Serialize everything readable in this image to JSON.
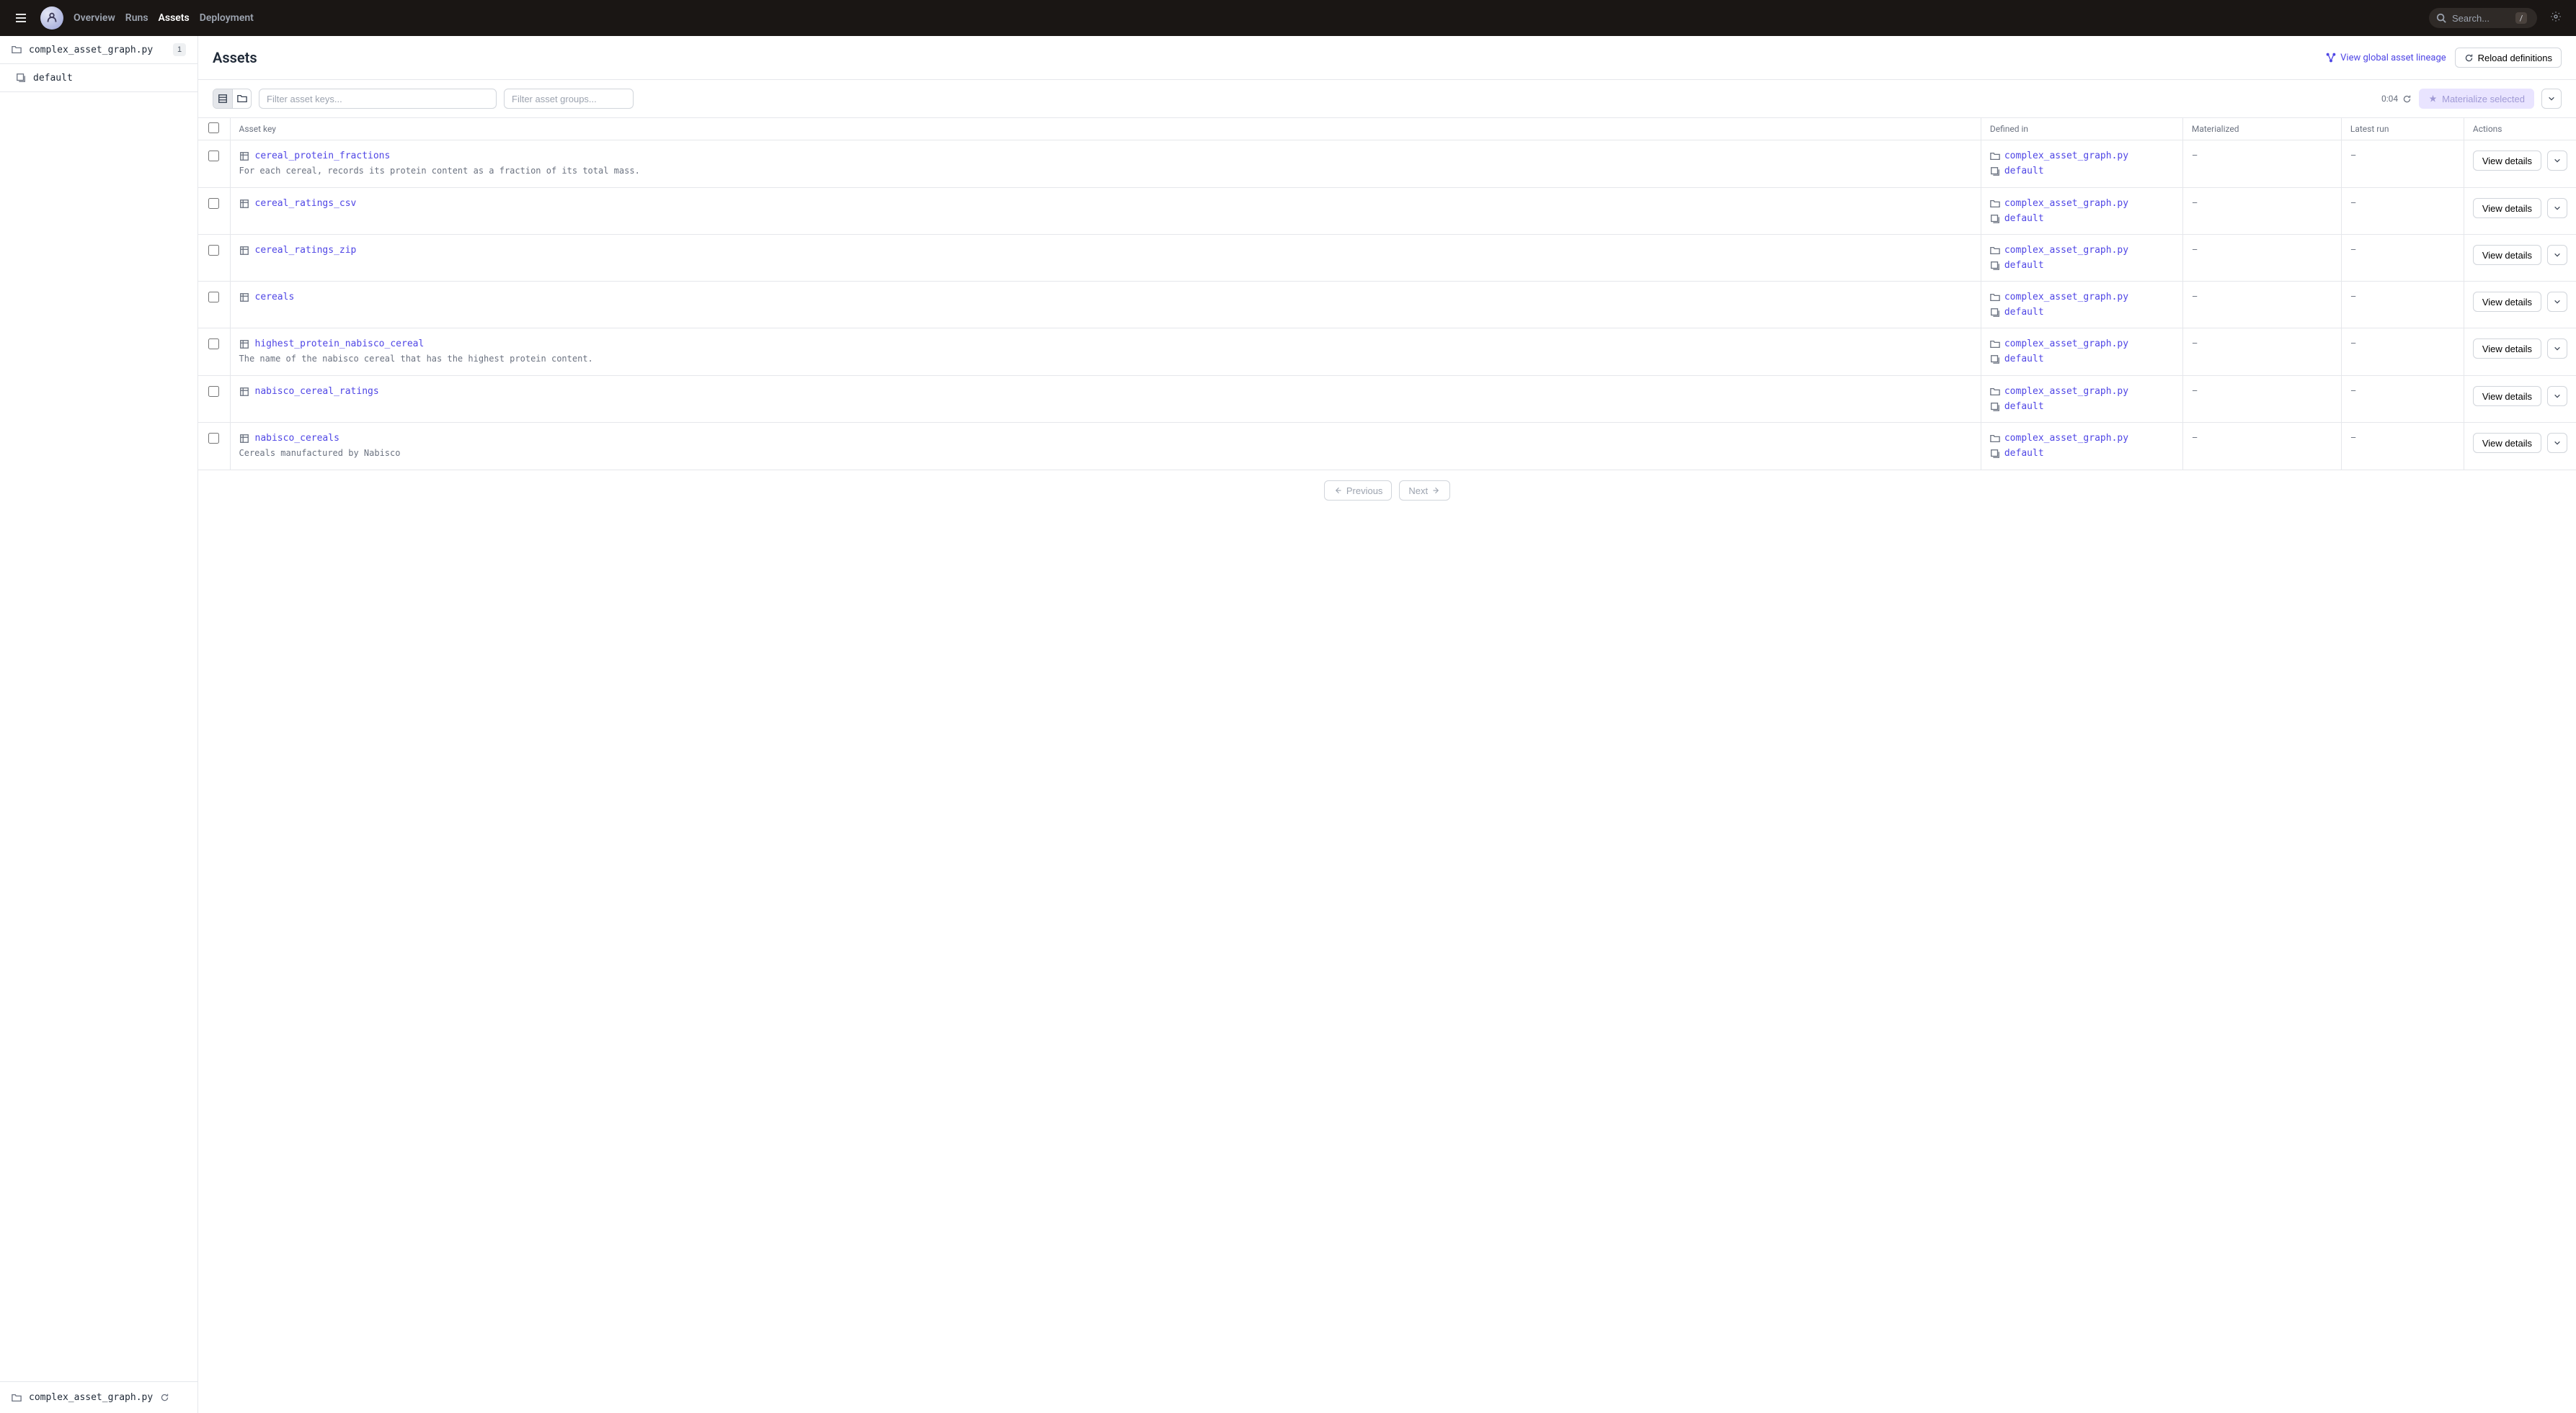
{
  "nav": {
    "links": [
      "Overview",
      "Runs",
      "Assets",
      "Deployment"
    ],
    "active": "Assets",
    "search_placeholder": "Search...",
    "search_kbd": "/"
  },
  "sidebar": {
    "items": [
      {
        "icon": "folder",
        "label": "complex_asset_graph.py",
        "badge": "1"
      },
      {
        "icon": "layers",
        "label": "default",
        "sub": true
      }
    ],
    "footer": {
      "icon": "folder",
      "label": "complex_asset_graph.py"
    }
  },
  "header": {
    "title": "Assets",
    "lineage_link": "View global asset lineage",
    "reload_btn": "Reload definitions"
  },
  "toolbar": {
    "filter_keys_placeholder": "Filter asset keys...",
    "filter_groups_placeholder": "Filter asset groups...",
    "timer": "0:04",
    "materialize_btn": "Materialize selected"
  },
  "table": {
    "headers": {
      "asset_key": "Asset key",
      "defined_in": "Defined in",
      "materialized": "Materialized",
      "latest_run": "Latest run",
      "actions": "Actions"
    },
    "view_details_label": "View details",
    "rows": [
      {
        "name": "cereal_protein_fractions",
        "desc": "For each cereal, records its protein content as a fraction of its total mass.",
        "defined_file": "complex_asset_graph.py",
        "defined_group": "default",
        "materialized": "–",
        "latest_run": "–"
      },
      {
        "name": "cereal_ratings_csv",
        "desc": "",
        "defined_file": "complex_asset_graph.py",
        "defined_group": "default",
        "materialized": "–",
        "latest_run": "–"
      },
      {
        "name": "cereal_ratings_zip",
        "desc": "",
        "defined_file": "complex_asset_graph.py",
        "defined_group": "default",
        "materialized": "–",
        "latest_run": "–"
      },
      {
        "name": "cereals",
        "desc": "",
        "defined_file": "complex_asset_graph.py",
        "defined_group": "default",
        "materialized": "–",
        "latest_run": "–"
      },
      {
        "name": "highest_protein_nabisco_cereal",
        "desc": "The name of the nabisco cereal that has the highest protein content.",
        "defined_file": "complex_asset_graph.py",
        "defined_group": "default",
        "materialized": "–",
        "latest_run": "–"
      },
      {
        "name": "nabisco_cereal_ratings",
        "desc": "",
        "defined_file": "complex_asset_graph.py",
        "defined_group": "default",
        "materialized": "–",
        "latest_run": "–"
      },
      {
        "name": "nabisco_cereals",
        "desc": "Cereals manufactured by Nabisco",
        "defined_file": "complex_asset_graph.py",
        "defined_group": "default",
        "materialized": "–",
        "latest_run": "–"
      }
    ]
  },
  "pagination": {
    "previous": "Previous",
    "next": "Next"
  }
}
